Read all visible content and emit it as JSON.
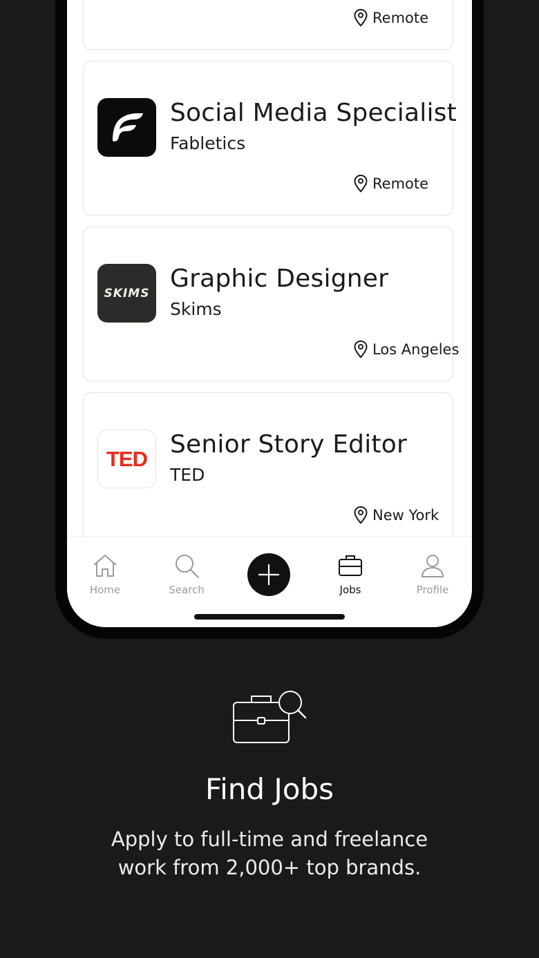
{
  "jobs": [
    {
      "title": "",
      "company": "",
      "location": "Remote"
    },
    {
      "title": "Social Media Specialist",
      "company": "Fabletics",
      "location": "Remote",
      "logo": "fabletics-logo"
    },
    {
      "title": "Graphic Designer",
      "company": "Skims",
      "location": "Los Angeles",
      "logo": "skims-logo",
      "logo_text": "SKIMS"
    },
    {
      "title": "Senior Story Editor",
      "company": "TED",
      "location": "New York",
      "logo": "ted-logo",
      "logo_text": "TED"
    }
  ],
  "tabbar": {
    "items": [
      {
        "label": "Home",
        "icon": "home-icon",
        "active": false
      },
      {
        "label": "Search",
        "icon": "search-icon",
        "active": false
      },
      {
        "label": "",
        "icon": "plus-icon",
        "active": false
      },
      {
        "label": "Jobs",
        "icon": "briefcase-icon",
        "active": true
      },
      {
        "label": "Profile",
        "icon": "person-icon",
        "active": false
      }
    ]
  },
  "promo": {
    "icon": "briefcase-search-icon",
    "title": "Find Jobs",
    "subtitle": "Apply to full-time and freelance work from 2,000+ top brands."
  },
  "colors": {
    "background": "#1a1a1a",
    "ted_red": "#e62b1e",
    "tab_inactive": "#9a9a9a",
    "tab_active": "#111111"
  }
}
